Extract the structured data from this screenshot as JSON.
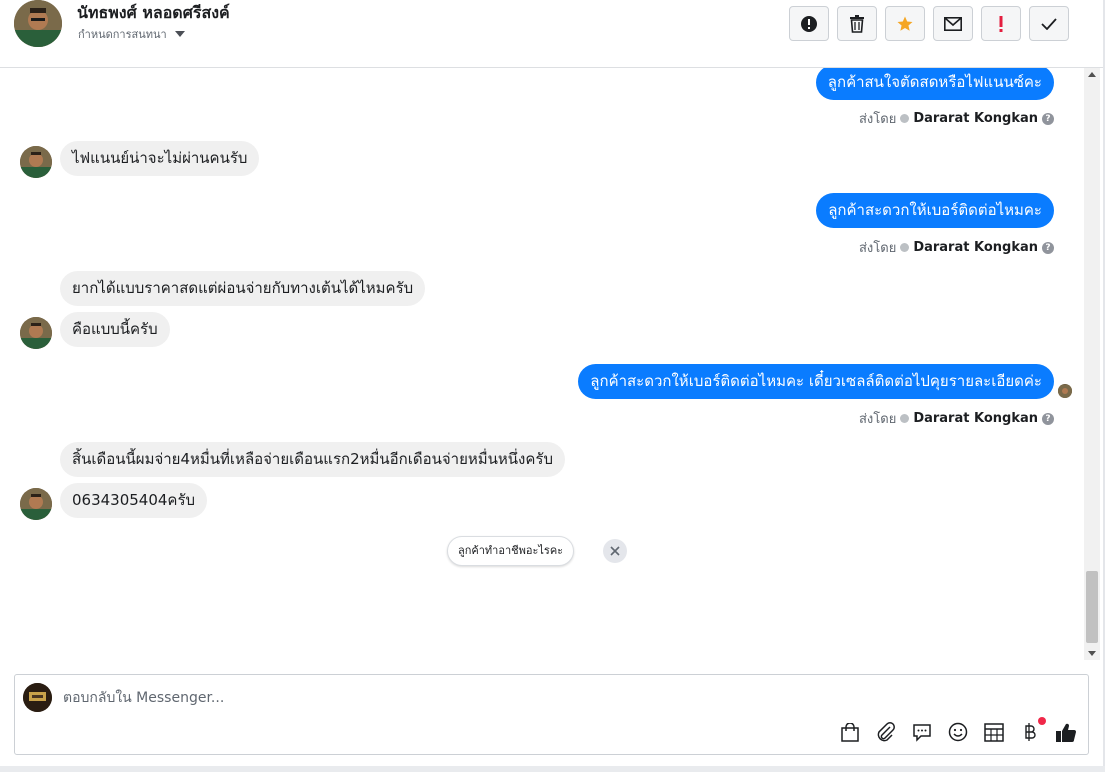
{
  "header": {
    "name": "นัทธพงศ์ หลอดศรีสงค์",
    "subtitle": "กำหนดการสนทนา",
    "actions": [
      {
        "name": "spam-button",
        "icon": "alert-circle-icon"
      },
      {
        "name": "delete-button",
        "icon": "trash-icon"
      },
      {
        "name": "star-button",
        "icon": "star-icon"
      },
      {
        "name": "mark-unread-button",
        "icon": "envelope-icon"
      },
      {
        "name": "follow-up-button",
        "icon": "exclamation-icon"
      },
      {
        "name": "done-button",
        "icon": "checkmark-icon"
      }
    ]
  },
  "colors": {
    "outgoing": "#0a7cff",
    "incoming": "#f0f0f0",
    "star": "#f5a623",
    "alert": "#e41e3f"
  },
  "messages": {
    "out1": {
      "text": "ลูกค้าสนใจตัดสดหรือไฟแนนซ์คะ",
      "sent_label": "ส่งโดย",
      "agent": "Dararat Kongkan"
    },
    "in1": {
      "text": "ไฟแนนย์น่าจะไม่ผ่านคนรับ"
    },
    "out2": {
      "text": "ลูกค้าสะดวกให้เบอร์ติดต่อไหมคะ",
      "sent_label": "ส่งโดย",
      "agent": "Dararat Kongkan"
    },
    "in2a": {
      "text": "ยากได้แบบราคาสดแต่ผ่อนจ่ายกับทางเต้นได้ไหมครับ"
    },
    "in2b": {
      "text": "คือแบบนี้ครับ"
    },
    "out3": {
      "text": "ลูกค้าสะดวกให้เบอร์ติดต่อไหมคะ เดี๋ยวเซลล์ติดต่อไปคุยรายละเอียดค่ะ",
      "sent_label": "ส่งโดย",
      "agent": "Dararat Kongkan"
    },
    "in3a": {
      "text": "สิ้นเดือนนี้ผมจ่าย4หมื่นที่เหลือจ่ายเดือนแรก2หมื่นอีกเดือนจ่ายหมื่นหนึ่งครับ"
    },
    "in3b": {
      "text": "0634305404ครับ"
    }
  },
  "suggestion": {
    "text": "ลูกค้าทำอาชีพอะไรคะ"
  },
  "composer": {
    "placeholder": "ตอบกลับใน Messenger...",
    "tools": [
      "shopping-bag-icon",
      "paperclip-icon",
      "saved-reply-icon",
      "emoji-icon",
      "table-icon",
      "baht-icon",
      "thumbs-up-icon"
    ]
  }
}
